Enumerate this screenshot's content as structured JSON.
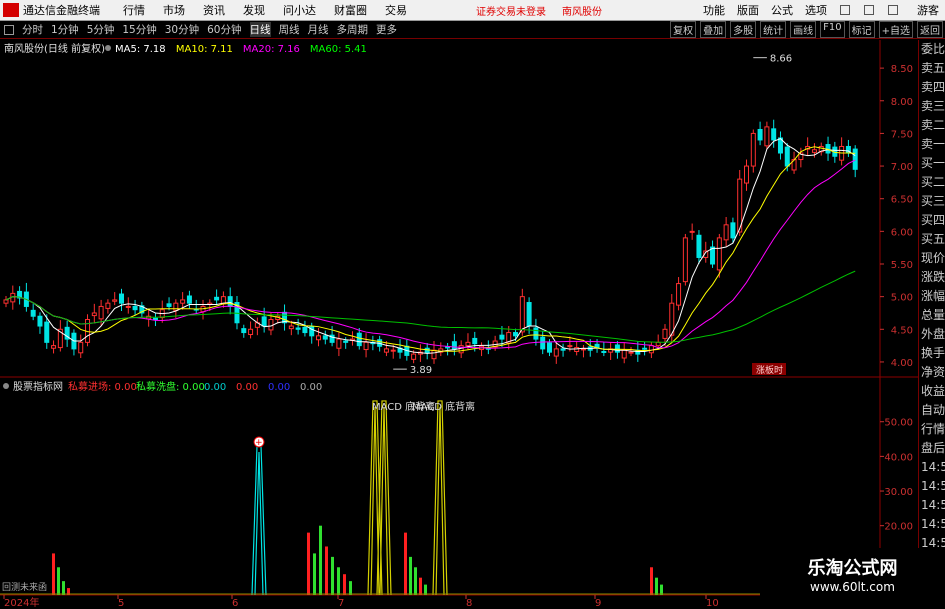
{
  "menubar": {
    "app_name": "通达信金融终端",
    "menus": [
      "行情",
      "市场",
      "资讯",
      "发现",
      "问小达",
      "财富圈",
      "交易"
    ],
    "notice": "证券交易未登录",
    "stock": "南风股份",
    "right": [
      "功能",
      "版面",
      "公式",
      "选项"
    ],
    "guest": "游客"
  },
  "periodbar": {
    "periods": [
      "分时",
      "1分钟",
      "5分钟",
      "15分钟",
      "30分钟",
      "60分钟",
      "日线",
      "周线",
      "月线",
      "多周期",
      "更多"
    ],
    "active": "日线",
    "right": [
      "复权",
      "叠加",
      "多股",
      "统计",
      "画线",
      "F10",
      "标记",
      "+自选",
      "返回"
    ]
  },
  "main": {
    "title": "南风股份(日线 前复权)",
    "ma": [
      {
        "label": "MA5: 7.18",
        "color": "#ffffff"
      },
      {
        "label": "MA10: 7.11",
        "color": "#ffff00"
      },
      {
        "label": "MA20: 7.16",
        "color": "#ff00ff"
      },
      {
        "label": "MA60: 5.41",
        "color": "#00ff00"
      }
    ],
    "max_label": "8.66",
    "min_label": "3.89",
    "tag": "涨板时"
  },
  "indicator": {
    "name": "股票指标网",
    "items": [
      {
        "label": "私募进场: 0.00",
        "color": "#ff3030"
      },
      {
        "label": "私募洗盘: 0.00",
        "color": "#30ff30"
      },
      {
        "label": "0.00",
        "color": "#00cccc"
      },
      {
        "label": "0.00",
        "color": "#ff3030"
      },
      {
        "label": "0.00",
        "color": "#3030ff"
      },
      {
        "label": "0.00",
        "color": "#aaaaaa"
      }
    ],
    "macd_label": "MACD 底背离",
    "left_caption": "回测未来函"
  },
  "sidebar": [
    "委比",
    "卖五",
    "卖四",
    "卖三",
    "卖二",
    "卖一",
    "买一",
    "买二",
    "买三",
    "买四",
    "买五",
    "现价",
    "涨跌",
    "涨幅",
    "总量",
    "外盘",
    "换手",
    "净资",
    "收益",
    "自动",
    "行情",
    "盘后",
    "14:5",
    "14:5",
    "14:5",
    "14:5",
    "14:5",
    "14:5",
    "14:5"
  ],
  "watermark": {
    "title": "乐淘公式网",
    "url": "www.60lt.com"
  },
  "chart_data": [
    {
      "type": "candlestick",
      "yaxis_ticks": [
        8.5,
        8.0,
        7.5,
        7.0,
        6.5,
        6.0,
        5.5,
        5.0,
        4.5,
        4.0
      ],
      "ylim": [
        3.8,
        8.9
      ],
      "xaxis_ticks": [
        "2024年",
        "5",
        "6",
        "7",
        "8",
        "9",
        "10"
      ],
      "close": [
        4.95,
        5.05,
        4.98,
        4.85,
        4.7,
        4.55,
        4.3,
        4.25,
        4.5,
        4.35,
        4.2,
        4.3,
        4.65,
        4.75,
        4.85,
        4.9,
        4.95,
        4.9,
        4.85,
        4.8,
        4.75,
        4.7,
        4.65,
        4.8,
        4.85,
        4.9,
        4.95,
        4.9,
        4.8,
        4.85,
        4.9,
        4.95,
        5.0,
        4.85,
        4.6,
        4.45,
        4.5,
        4.6,
        4.55,
        4.65,
        4.7,
        4.6,
        4.55,
        4.5,
        4.45,
        4.4,
        4.4,
        4.35,
        4.3,
        4.35,
        4.3,
        4.35,
        4.25,
        4.3,
        4.28,
        4.24,
        4.2,
        4.18,
        4.15,
        4.1,
        4.12,
        4.15,
        4.14,
        4.18,
        4.2,
        4.22,
        4.2,
        4.25,
        4.3,
        4.28,
        4.24,
        4.2,
        4.32,
        4.35,
        4.45,
        4.4,
        5.0,
        4.55,
        4.35,
        4.2,
        4.15,
        4.2,
        4.18,
        4.25,
        4.22,
        4.2,
        4.18,
        4.22,
        4.15,
        4.2,
        4.15,
        4.18,
        4.15,
        4.12,
        4.2,
        4.25,
        4.3,
        4.5,
        4.9,
        5.2,
        5.9,
        6.0,
        5.6,
        5.7,
        5.5,
        5.9,
        6.1,
        5.9,
        6.8,
        7.0,
        7.5,
        7.4,
        7.6,
        7.4,
        7.2,
        7.0,
        7.1,
        7.2,
        7.3,
        7.25,
        7.3,
        7.2,
        7.15,
        7.3,
        7.2,
        6.95
      ],
      "annotations": {
        "max": 8.66,
        "min": 3.89
      },
      "series": [
        {
          "name": "MA5",
          "last": 7.18
        },
        {
          "name": "MA10",
          "last": 7.11
        },
        {
          "name": "MA20",
          "last": 7.16
        },
        {
          "name": "MA60",
          "last": 5.41
        }
      ]
    },
    {
      "type": "bar",
      "yaxis_ticks": [
        50.0,
        40.0,
        30.0,
        20.0,
        10.0
      ],
      "ylim": [
        0,
        58
      ],
      "spikes": [
        {
          "value": 43,
          "color": "#00e5e5",
          "marked": true
        },
        {
          "value": 56,
          "color": "#d4d000"
        },
        {
          "value": 56,
          "color": "#d4d000"
        },
        {
          "value": 56,
          "color": "#d4d000"
        }
      ],
      "bars_left": [
        12,
        8,
        4,
        2
      ],
      "bars_mid": [
        18,
        12,
        20,
        14,
        11,
        8,
        6,
        4
      ],
      "bars_late": [
        18,
        11,
        8,
        5,
        3
      ],
      "bars_right": [
        8,
        5,
        3
      ]
    }
  ]
}
